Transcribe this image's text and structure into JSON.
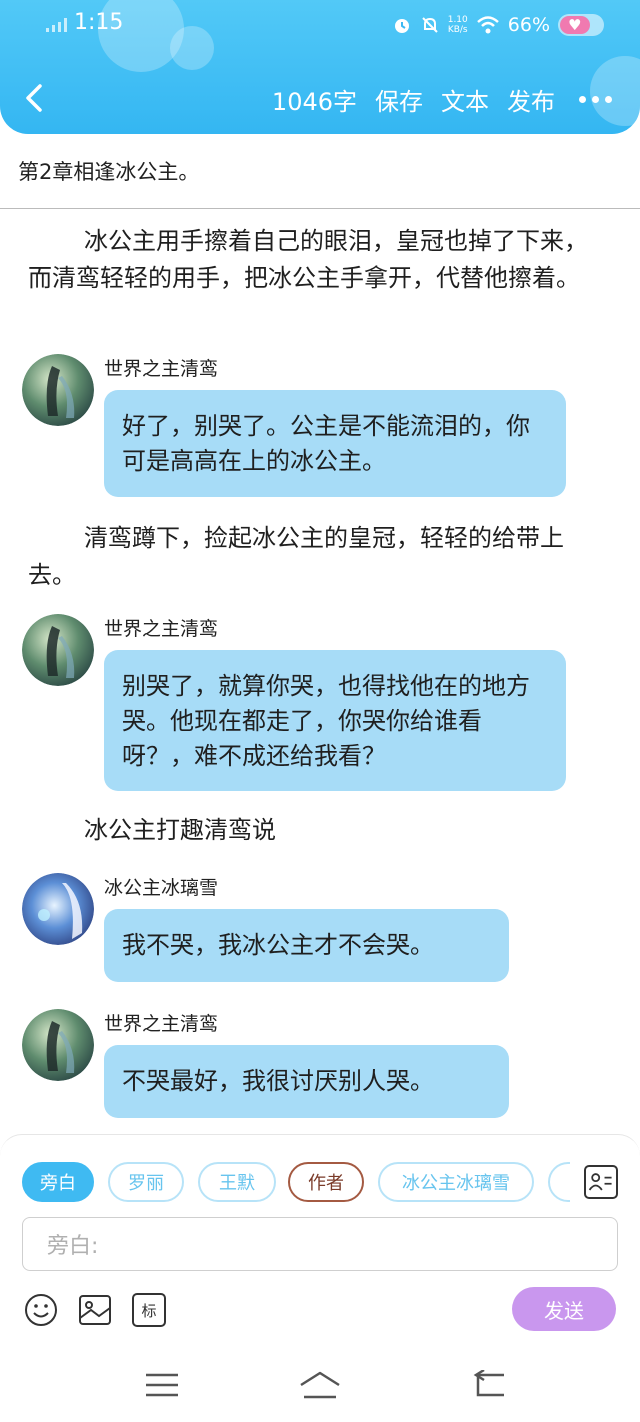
{
  "status_bar": {
    "time": "1:15",
    "net_speed_value": "1.10",
    "net_speed_unit": "KB/s",
    "battery_percent": "66%"
  },
  "toolbar": {
    "word_count": "1046字",
    "save_label": "保存",
    "text_label": "文本",
    "publish_label": "发布"
  },
  "chapter_title": "第2章相逢冰公主。",
  "content": {
    "narration_1": "冰公主用手擦着自己的眼泪，皇冠也掉了下来，而清鸾轻轻的用手，把冰公主手拿开，代替他擦着。",
    "message_1": {
      "speaker": "世界之主清鸾",
      "text": "好了，别哭了。公主是不能流泪的，你可是高高在上的冰公主。"
    },
    "narration_2": "清鸾蹲下，捡起冰公主的皇冠，轻轻的给带上去。",
    "message_2": {
      "speaker": "世界之主清鸾",
      "text": "别哭了，就算你哭，也得找他在的地方哭。他现在都走了，你哭你给谁看呀？，难不成还给我看？"
    },
    "narration_3": "冰公主打趣清鸾说",
    "message_3": {
      "speaker": "冰公主冰璃雪",
      "text": "我不哭，我冰公主才不会哭。"
    },
    "message_4": {
      "speaker": "世界之主清鸾",
      "text": "不哭最好，我很讨厌别人哭。"
    }
  },
  "roles": {
    "narrator": "旁白",
    "role_1": "罗丽",
    "role_2": "王默",
    "author": "作者",
    "role_3": "冰公主冰璃雪"
  },
  "input": {
    "placeholder": "旁白:"
  },
  "tools": {
    "tag_label": "标",
    "send_label": "发送"
  },
  "colors": {
    "header": "#3bb9f3",
    "bubble": "#a7dcf7",
    "send_button": "#c997ee",
    "active_chip": "#3fbaf2"
  }
}
